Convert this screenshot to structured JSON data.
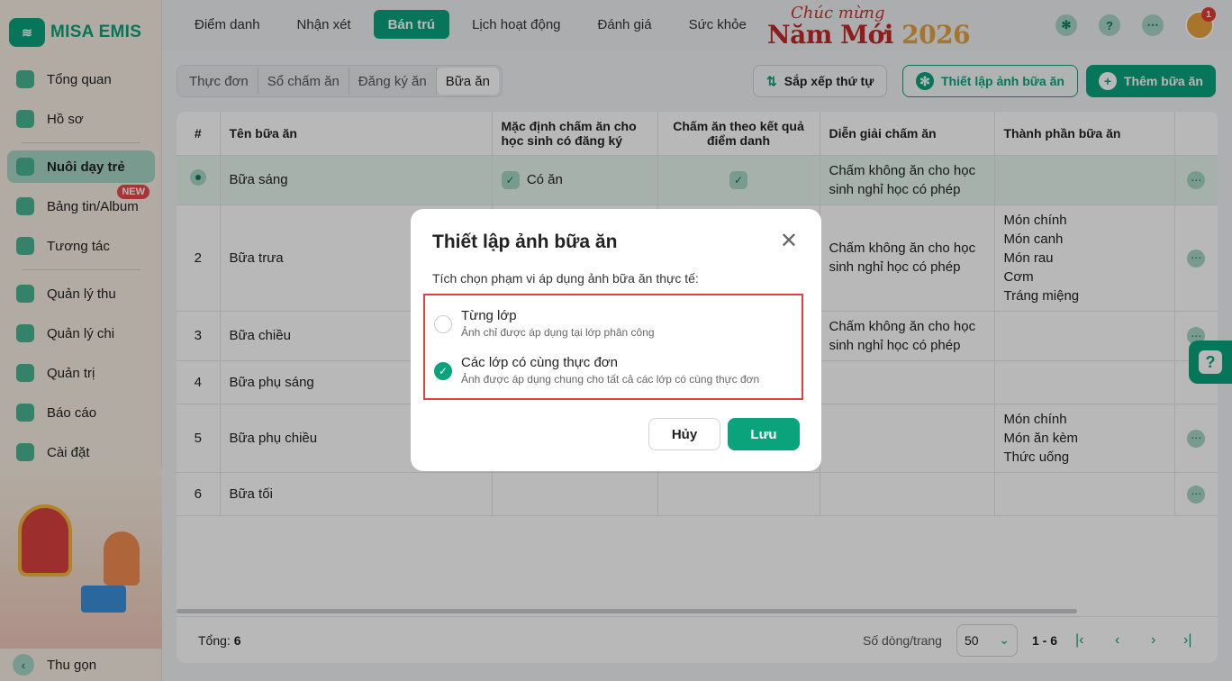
{
  "app": {
    "logo_mark": "≋",
    "logo_text": "MISA EMIS"
  },
  "sidebar": {
    "items": [
      {
        "label": "Tổng quan",
        "icon": "pie-chart-icon"
      },
      {
        "label": "Hồ sơ",
        "icon": "folder-icon"
      },
      {
        "label": "Nuôi dạy trẻ",
        "icon": "home-icon"
      },
      {
        "label": "Bảng tin/Album",
        "icon": "image-icon",
        "badge": "NEW"
      },
      {
        "label": "Tương tác",
        "icon": "send-icon"
      },
      {
        "label": "Quản lý thu",
        "icon": "chart-icon"
      },
      {
        "label": "Quản lý chi",
        "icon": "wallet-icon"
      },
      {
        "label": "Quản trị",
        "icon": "briefcase-icon"
      },
      {
        "label": "Báo cáo",
        "icon": "bar-chart-icon"
      },
      {
        "label": "Cài đặt",
        "icon": "gear-icon"
      }
    ],
    "collapse_label": "Thu gọn",
    "collapse_arrow": "‹"
  },
  "topbar": {
    "tabs": [
      "Điểm danh",
      "Nhận xét",
      "Bán trú",
      "Lịch hoạt động",
      "Đánh giá",
      "Sức khỏe"
    ],
    "banner_sub": "Chúc mừng",
    "banner_main": "Năm Mới",
    "banner_year": "2026",
    "help_glyph": "?",
    "more_glyph": "⋯",
    "gear_glyph": "✻",
    "notif_count": "1"
  },
  "subtabs": [
    "Thực đơn",
    "Sổ chấm ăn",
    "Đăng ký ăn",
    "Bữa ăn"
  ],
  "actions": {
    "sort": "Sắp xếp thứ tự",
    "photo_setup": "Thiết lập ảnh bữa ăn",
    "add_meal": "Thêm bữa ăn",
    "sort_glyph": "⇅",
    "photo_glyph": "✻",
    "add_glyph": "+"
  },
  "table": {
    "headers": [
      "#",
      "Tên bữa ăn",
      "Mặc định chấm ăn cho học sinh có đăng ký",
      "Chấm ăn theo kết quả điểm danh",
      "Diễn giải chấm ăn",
      "Thành phần bữa ăn",
      ""
    ],
    "rows": [
      {
        "no": "",
        "name": "Bữa sáng",
        "default": "Có ăn",
        "attend": "✓",
        "note": "Chấm không ăn cho học sinh nghỉ học có phép",
        "components": ""
      },
      {
        "no": "2",
        "name": "Bữa trưa",
        "default": "",
        "attend": "",
        "note": "Chấm không ăn cho học sinh nghỉ học có phép",
        "components": "Món chính\nMón canh\nMón rau\nCơm\nTráng miệng"
      },
      {
        "no": "3",
        "name": "Bữa chiều",
        "default": "",
        "attend": "",
        "note": "Chấm không ăn cho học sinh nghỉ học có phép",
        "components": ""
      },
      {
        "no": "4",
        "name": "Bữa phụ sáng",
        "default": "",
        "attend": "",
        "note": "",
        "components": ""
      },
      {
        "no": "5",
        "name": "Bữa phụ chiều",
        "default": "",
        "attend": "",
        "note": "",
        "components": "Món chính\nMón ăn kèm\nThức uống"
      },
      {
        "no": "6",
        "name": "Bữa tối",
        "default": "",
        "attend": "",
        "note": "",
        "components": ""
      }
    ],
    "check_glyph": "✓",
    "more_glyph": "⋯"
  },
  "footer": {
    "total_label": "Tổng:",
    "total_value": "6",
    "rows_label": "Số dòng/trang",
    "rows_value": "50",
    "range": "1 - 6",
    "first": "|‹",
    "prev": "‹",
    "next": "›",
    "last": "›|",
    "chevron": "⌄"
  },
  "modal": {
    "title": "Thiết lập ảnh bữa ăn",
    "close": "✕",
    "desc": "Tích chọn phạm vi áp dụng ảnh bữa ăn thực tế:",
    "options": [
      {
        "title": "Từng lớp",
        "sub": "Ảnh chỉ được áp dụng tại lớp phân công",
        "selected": false
      },
      {
        "title": "Các lớp có cùng thực đơn",
        "sub": "Ảnh được áp dụng chung cho tất cả các lớp có cùng thực đơn",
        "selected": true
      }
    ],
    "cancel": "Hủy",
    "save": "Lưu",
    "check_glyph": "✓"
  },
  "help_float": "?",
  "colors": {
    "accent": "#0ba37c",
    "highlight": "#d9453a",
    "badge": "#e84a4a"
  }
}
